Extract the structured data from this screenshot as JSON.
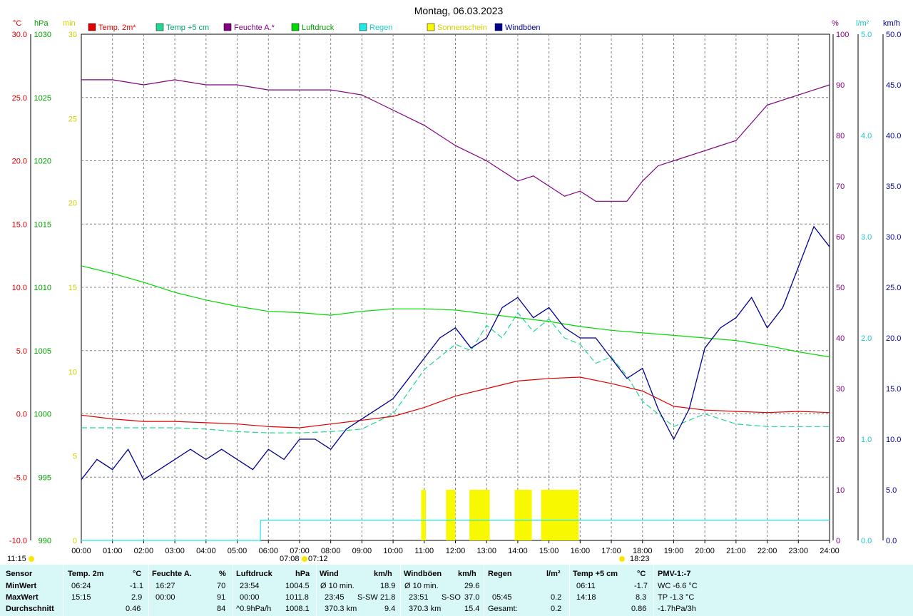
{
  "title": "Montag, 06.03.2023",
  "time_label": "11:15",
  "axis_units": {
    "temp": "°C",
    "pressure": "hPa",
    "sun": "min",
    "humidity": "%",
    "rain": "l/m²",
    "wind": "km/h"
  },
  "colors": {
    "temp2m": "#e00000",
    "temp5cm": "#20d890",
    "humidity": "#800080",
    "pressure": "#00d800",
    "rain": "#20e8e8",
    "sun": "#f8f800",
    "wind": "#000090",
    "grid": "#808080"
  },
  "sunrise_label": "07:08",
  "sunset_label": "07:12",
  "moon_label": "18:23",
  "chart_data": {
    "type": "line",
    "title": "Montag, 06.03.2023",
    "x_ticks": [
      "00:00",
      "01:00",
      "02:00",
      "03:00",
      "04:00",
      "05:00",
      "06:00",
      "07:00",
      "08:00",
      "09:00",
      "10:00",
      "11:00",
      "12:00",
      "13:00",
      "14:00",
      "15:00",
      "16:00",
      "17:00",
      "18:00",
      "19:00",
      "20:00",
      "21:00",
      "22:00",
      "23:00",
      "24:00"
    ],
    "axes": {
      "temp": {
        "unit": "°C",
        "range": [
          -10,
          30
        ],
        "ticks": [
          "-10.0",
          "-5.0",
          "0.0",
          "5.0",
          "10.0",
          "15.0",
          "20.0",
          "25.0",
          "30.0"
        ]
      },
      "pressure": {
        "unit": "hPa",
        "range": [
          990,
          1030
        ],
        "ticks": [
          "990",
          "995",
          "1000",
          "1005",
          "1010",
          "1015",
          "1020",
          "1025",
          "1030"
        ]
      },
      "sun": {
        "unit": "min",
        "range": [
          0,
          30
        ],
        "ticks": [
          "0",
          "5",
          "10",
          "15",
          "20",
          "25",
          "30"
        ]
      },
      "humidity": {
        "unit": "%",
        "range": [
          0,
          100
        ],
        "ticks": [
          "0",
          "10",
          "20",
          "30",
          "40",
          "50",
          "60",
          "70",
          "80",
          "90",
          "100"
        ]
      },
      "rain": {
        "unit": "l/m²",
        "range": [
          0,
          5
        ],
        "ticks": [
          "0.0",
          "1.0",
          "2.0",
          "3.0",
          "4.0",
          "5.0"
        ]
      },
      "wind": {
        "unit": "km/h",
        "range": [
          0,
          50
        ],
        "ticks": [
          "0.0",
          "5.0",
          "10.0",
          "15.0",
          "20.0",
          "25.0",
          "30.0",
          "35.0",
          "40.0",
          "45.0",
          "50.0"
        ]
      }
    },
    "legend": [
      "Temp. 2m*",
      "Temp +5 cm",
      "Feuchte A.*",
      "Luftdruck",
      "Regen",
      "Sonnenschein",
      "Windböen"
    ],
    "grid": true,
    "series": [
      {
        "name": "Temp. 2m*",
        "axis": "temp",
        "x": [
          0,
          1,
          2,
          3,
          4,
          5,
          6,
          7,
          8,
          9,
          10,
          11,
          12,
          13,
          14,
          15,
          16,
          17,
          18,
          19,
          20,
          21,
          22,
          23,
          24
        ],
        "y": [
          -0.1,
          -0.4,
          -0.6,
          -0.6,
          -0.7,
          -0.8,
          -1.0,
          -1.1,
          -0.8,
          -0.5,
          -0.2,
          0.5,
          1.4,
          2.0,
          2.6,
          2.8,
          2.9,
          2.4,
          1.8,
          0.6,
          0.3,
          0.2,
          0.1,
          0.2,
          0.1
        ]
      },
      {
        "name": "Temp +5 cm",
        "axis": "temp",
        "x": [
          0,
          1,
          2,
          3,
          4,
          5,
          6,
          7,
          8,
          9,
          10,
          11,
          11.5,
          12,
          12.5,
          13,
          13.5,
          14,
          14.5,
          15,
          15.5,
          16,
          16.5,
          17,
          17.5,
          18,
          18.5,
          19,
          20,
          21,
          22,
          23,
          24
        ],
        "y": [
          -1.1,
          -1.1,
          -1.1,
          -1.1,
          -1.2,
          -1.4,
          -1.5,
          -1.5,
          -1.4,
          -1.2,
          0.0,
          3.5,
          4.5,
          5.5,
          5.0,
          7.0,
          6.0,
          8.0,
          6.5,
          7.5,
          6.0,
          5.5,
          4.0,
          4.5,
          3.0,
          1.0,
          0.0,
          -1.0,
          0.0,
          -0.8,
          -1.0,
          -1.0,
          -1.0
        ]
      },
      {
        "name": "Feuchte A.*",
        "axis": "humidity",
        "x": [
          0,
          1,
          2,
          3,
          4,
          5,
          6,
          7,
          8,
          9,
          10,
          11,
          12,
          13,
          13.5,
          14,
          14.5,
          15,
          15.5,
          16,
          16.5,
          17,
          17.5,
          18,
          18.5,
          19,
          20,
          21,
          22,
          23,
          24
        ],
        "y": [
          91,
          91,
          90,
          91,
          90,
          90,
          89,
          89,
          89,
          88,
          85,
          82,
          78,
          75,
          73,
          71,
          72,
          70,
          68,
          69,
          67,
          67,
          67,
          71,
          74,
          75,
          77,
          79,
          86,
          88,
          90
        ]
      },
      {
        "name": "Luftdruck",
        "axis": "pressure",
        "x": [
          0,
          1,
          2,
          3,
          4,
          5,
          6,
          7,
          8,
          9,
          10,
          11,
          12,
          13,
          14,
          15,
          16,
          17,
          18,
          19,
          20,
          21,
          22,
          23,
          24
        ],
        "y": [
          1011.7,
          1011.1,
          1010.4,
          1009.6,
          1009.0,
          1008.5,
          1008.1,
          1008.0,
          1007.8,
          1008.1,
          1008.3,
          1008.3,
          1008.2,
          1007.9,
          1007.6,
          1007.3,
          1006.9,
          1006.6,
          1006.4,
          1006.2,
          1006.0,
          1005.8,
          1005.4,
          1004.9,
          1004.5
        ]
      },
      {
        "name": "Regen",
        "axis": "rain",
        "x": [
          0,
          5.74,
          5.75,
          24
        ],
        "y": [
          0,
          0,
          0.2,
          0.2
        ]
      },
      {
        "name": "Windböen",
        "axis": "wind",
        "x": [
          0,
          0.5,
          1,
          1.5,
          2,
          2.5,
          3,
          3.5,
          4,
          4.5,
          5,
          5.5,
          6,
          6.5,
          7,
          7.5,
          8,
          8.5,
          9,
          9.5,
          10,
          10.5,
          11,
          11.5,
          12,
          12.5,
          13,
          13.5,
          14,
          14.5,
          15,
          15.5,
          16,
          16.5,
          17,
          17.5,
          18,
          18.5,
          19,
          19.5,
          20,
          20.5,
          21,
          21.5,
          22,
          22.5,
          23,
          23.5,
          24
        ],
        "y": [
          6,
          8,
          7,
          9,
          6,
          7,
          8,
          9,
          8,
          9,
          8,
          7,
          9,
          8,
          10,
          10,
          9,
          11,
          12,
          13,
          14,
          16,
          18,
          20,
          21,
          19,
          20,
          23,
          24,
          22,
          23,
          21,
          20,
          20,
          18,
          16,
          17,
          13,
          10,
          13,
          19,
          21,
          22,
          24,
          21,
          23,
          27,
          31,
          29
        ]
      },
      {
        "name": "Sonnenschein",
        "type": "bar",
        "axis": "sun",
        "intervals": [
          [
            10.9,
            11.05
          ],
          [
            11.7,
            12.0
          ],
          [
            12.45,
            13.1
          ],
          [
            13.9,
            14.45
          ],
          [
            14.75,
            15.95
          ]
        ],
        "value": 3
      }
    ],
    "stats_table": {
      "rows": [
        "Sensor",
        "MinWert",
        "MaxWert",
        "Durchschnitt"
      ],
      "columns": [
        {
          "name": "Temp. 2m",
          "unit": "°C",
          "min_time": "06:24",
          "min": "-1.1",
          "max_time": "15:15",
          "max": "2.9",
          "avg": "0.46"
        },
        {
          "name": "Feuchte A.",
          "unit": "%",
          "min_time": "16:27",
          "min": "70",
          "max_time": "00:00",
          "max": "91",
          "avg": "84"
        },
        {
          "name": "Luftdruck",
          "unit": "hPa",
          "min_time": "23:54",
          "min": "1004.5",
          "max_time": "00:00",
          "max": "1011.8",
          "avg_label": "^0.9hPa/h",
          "avg": "1008.1"
        },
        {
          "name": "Wind",
          "unit": "km/h",
          "min_time": "Ø 10 min.",
          "min": "18.9",
          "max_time": "23:45",
          "max_dir": "S-SW",
          "max": "21.8",
          "avg_label": "370.3 km",
          "avg": "9.4"
        },
        {
          "name": "Windböen",
          "unit": "km/h",
          "min_time": "Ø 10 min.",
          "min": "29.6",
          "max_time": "23:51",
          "max_dir": "S-SO",
          "max": "37.0",
          "avg_label": "370.3 km",
          "avg": "15.4"
        },
        {
          "name": "Regen",
          "unit": "l/m²",
          "max_time": "05:45",
          "max": "0.2",
          "avg_label": "Gesamt:",
          "avg": "0.2"
        },
        {
          "name": "Temp +5 cm",
          "unit": "°C",
          "min_time": "06:11",
          "min": "-1.7",
          "max_time": "14:18",
          "max": "8.3",
          "avg": "0.86"
        },
        {
          "name": "PMV-1:-7",
          "min": "WC -6.6 °C",
          "max": "TP -1.3 °C",
          "avg": "-1.7hPa/3h"
        }
      ]
    }
  }
}
